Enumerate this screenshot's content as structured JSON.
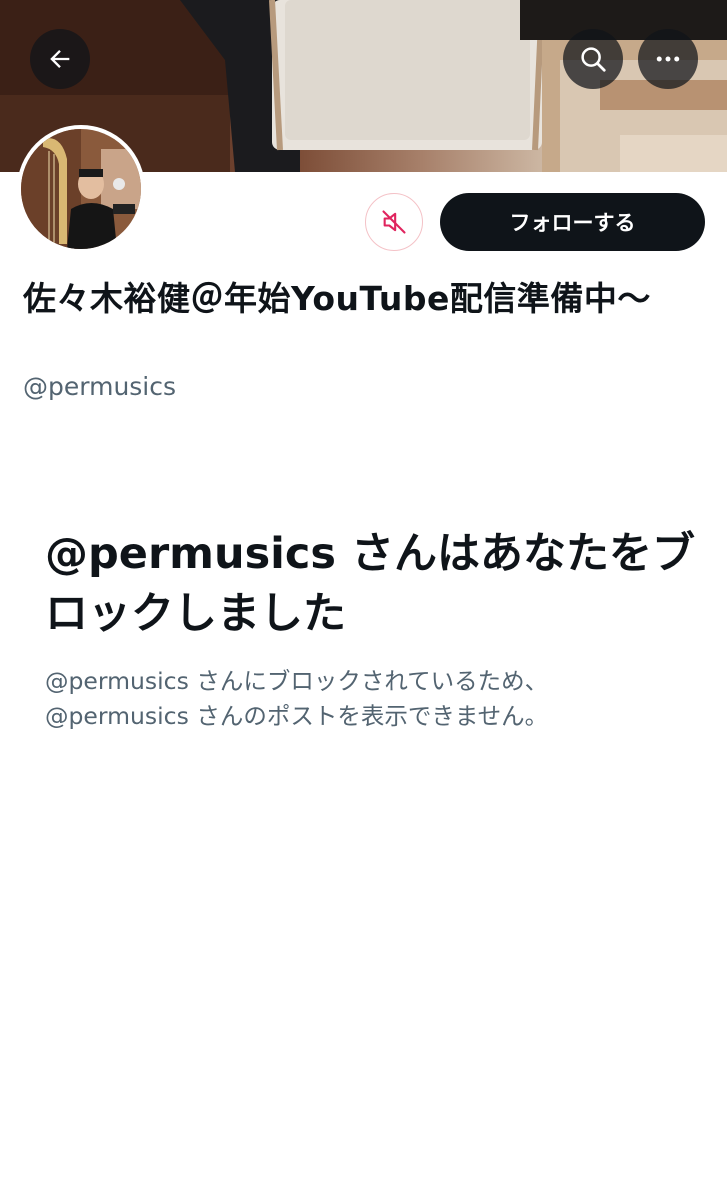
{
  "header": {
    "back_icon": "arrow-left-icon",
    "search_icon": "search-icon",
    "more_icon": "more-horizontal-icon"
  },
  "profile": {
    "display_name": "佐々木裕健＠年始YouTube配信準備中〜",
    "handle": "@permusics",
    "mute_icon": "speaker-muted-icon",
    "follow_label": "フォローする"
  },
  "blocked": {
    "title": "@permusics さんはあなたをブロックしました",
    "description_line1": "@permusics さんにブロックされているため、",
    "description_line2": "@permusics さんのポストを表示できません。"
  },
  "colors": {
    "primary_text": "#0f1419",
    "secondary_text": "#536471",
    "mute_accent": "#e0245e",
    "follow_bg": "#0f1419"
  }
}
